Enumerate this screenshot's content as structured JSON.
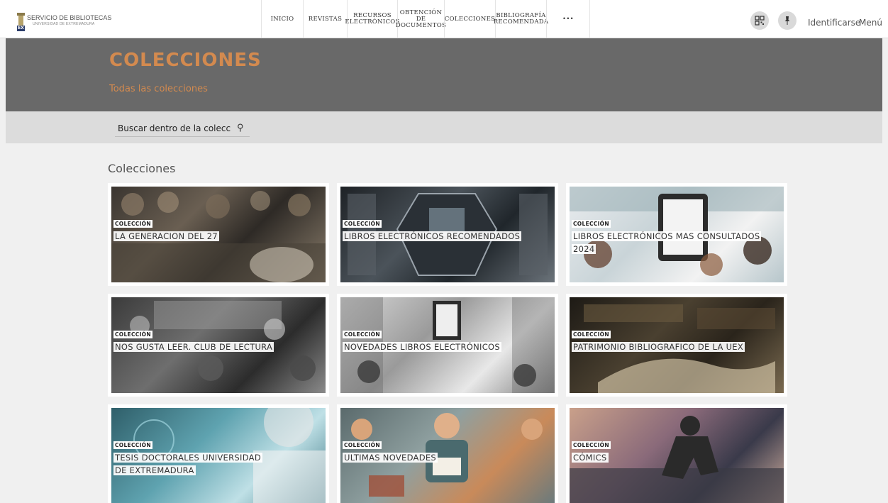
{
  "header": {
    "logo_title": "SERVICIO DE BIBLIOTECAS",
    "logo_subtitle": "UNIVERSIDAD DE EXTREMADURA",
    "logo_mark": "EX",
    "nav": [
      {
        "label": "INICIO"
      },
      {
        "label": "REVISTAS"
      },
      {
        "label": "RECURSOS ELECTRÓNICOS"
      },
      {
        "label": "OBTENCIÓN DE DOCUMENTOS"
      },
      {
        "label": "COLECCIONES"
      },
      {
        "label": "BIBLIOGRAFÍA RECOMENDADA"
      },
      {
        "label": "•••"
      }
    ],
    "icons": [
      "qr-code-icon",
      "pin-icon"
    ],
    "login": "Identificarse",
    "menu": "Menú"
  },
  "banner": {
    "title": "COLECCIONES",
    "subtitle": "Todas las colecciones"
  },
  "search": {
    "placeholder": "Buscar dentro de la colección"
  },
  "main": {
    "section_title": "Colecciones",
    "cards": [
      {
        "tag": "COLECCIÓN",
        "title": "LA GENERACION DEL 27"
      },
      {
        "tag": "COLECCIÓN",
        "title": "LIBROS ELECTRÓNICOS RECOMENDADOS"
      },
      {
        "tag": "COLECCIÓN",
        "title": "LIBROS ELECTRÓNICOS MAS CONSULTADOS 2024"
      },
      {
        "tag": "COLECCIÓN",
        "title": "NOS GUSTA LEER. CLUB DE LECTURA"
      },
      {
        "tag": "COLECCIÓN",
        "title": "NOVEDADES LIBROS ELECTRÓNICOS"
      },
      {
        "tag": "COLECCIÓN",
        "title": "PATRIMONIO BIBLIOGRAFICO DE LA UEX"
      },
      {
        "tag": "COLECCIÓN",
        "title": "TESIS DOCTORALES UNIVERSIDAD DE EXTREMADURA"
      },
      {
        "tag": "COLECCIÓN",
        "title": "ULTIMAS NOVEDADES"
      },
      {
        "tag": "COLECCIÓN",
        "title": "CÓMICS"
      }
    ]
  },
  "colors": {
    "accent": "#d38a4f",
    "banner_bg": "#696969",
    "search_bg": "#dcdcdc",
    "page_bg": "#f0f0f0"
  }
}
